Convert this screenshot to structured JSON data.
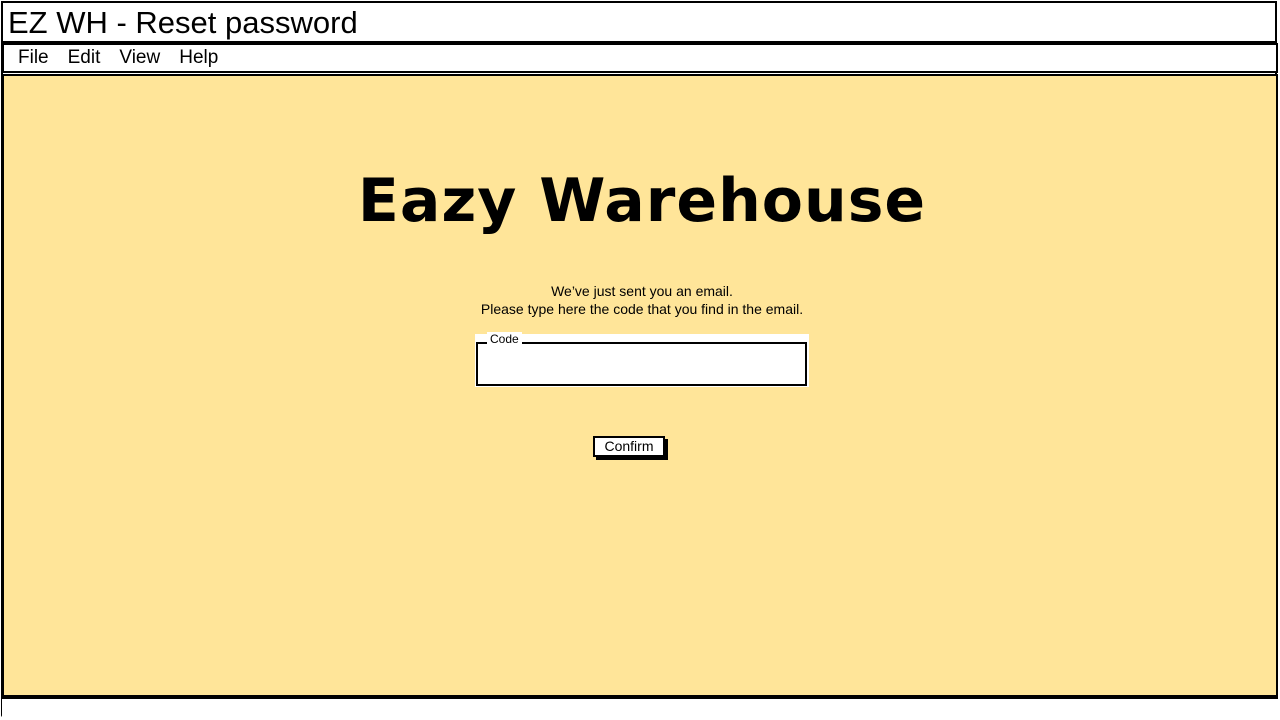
{
  "window": {
    "title": "EZ WH - Reset password"
  },
  "menu": {
    "items": [
      "File",
      "Edit",
      "View",
      "Help"
    ]
  },
  "main": {
    "app_title": "Eazy Warehouse",
    "message_line1": "We’ve just sent you an email.",
    "message_line2": "Please type here the code that you find in the email.",
    "code_field": {
      "label": "Code",
      "value": "",
      "placeholder": ""
    },
    "confirm_label": "Confirm"
  },
  "colors": {
    "content_background": "#ffe599",
    "border": "#000000"
  }
}
